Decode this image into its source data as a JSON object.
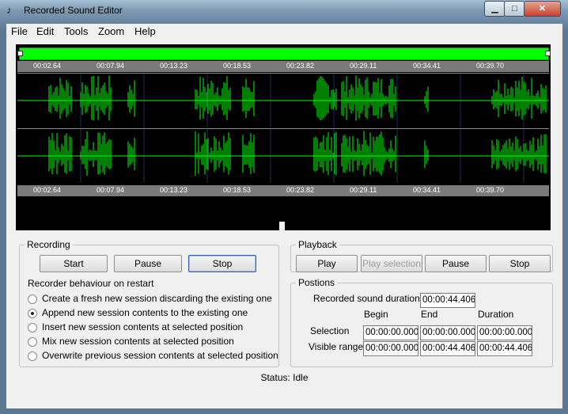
{
  "window": {
    "title": "Recorded Sound Editor",
    "icon": "music-note-icon"
  },
  "menu": [
    "File",
    "Edit",
    "Tools",
    "Zoom",
    "Help"
  ],
  "timeline": {
    "ticks": [
      "00:02.64",
      "00:07.94",
      "00:13.23",
      "00:18.53",
      "00:23.82",
      "00:29.11",
      "00:34.41",
      "00:39.70"
    ],
    "waveform_color": "#00ff00",
    "selection_bar_color": "#00ff00"
  },
  "recording": {
    "legend": "Recording",
    "start": "Start",
    "pause": "Pause",
    "stop": "Stop",
    "behaviour_label": "Recorder behaviour on restart",
    "options": [
      "Create a fresh new session discarding the existing one",
      "Append new session contents to the existing one",
      "Insert new session contents at selected position",
      "Mix new session contents at selected position",
      "Overwrite previous session contents at selected position"
    ],
    "selected_option": 1
  },
  "playback": {
    "legend": "Playback",
    "play": "Play",
    "play_selection": "Play selection",
    "pause": "Pause",
    "stop": "Stop"
  },
  "positions": {
    "legend": "Postions",
    "duration_label": "Recorded sound duration",
    "duration_value": "00:00:44.406",
    "col_begin": "Begin",
    "col_end": "End",
    "col_duration": "Duration",
    "selection_label": "Selection",
    "selection": [
      "00:00:00.000",
      "00:00:00.000",
      "00:00:00.000"
    ],
    "visible_label": "Visible range",
    "visible": [
      "00:00:00.000",
      "00:00:44.406",
      "00:00:44.406"
    ]
  },
  "status": "Status: Idle"
}
